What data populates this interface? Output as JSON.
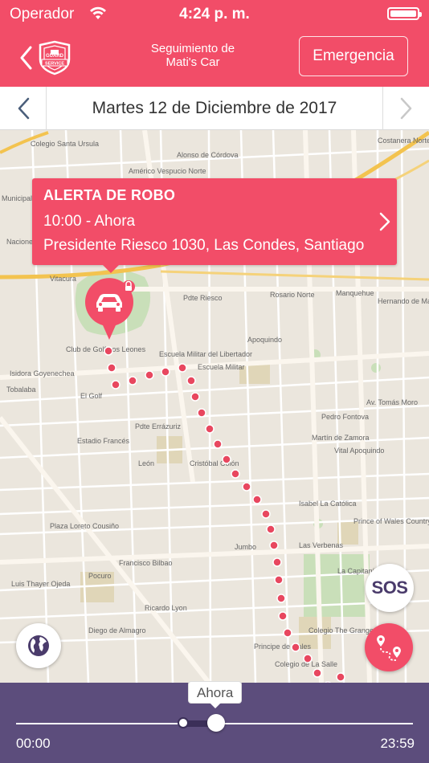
{
  "status": {
    "carrier": "Operador",
    "time": "4:24 p. m."
  },
  "nav": {
    "title_line1": "Seguimiento de",
    "title_line2": "Mati's Car",
    "emergency_label": "Emergencia",
    "logo_text_top": "GUARD",
    "logo_text_bottom": "SERVICE"
  },
  "date_bar": {
    "date": "Martes 12 de Diciembre de 2017"
  },
  "alert": {
    "title": "ALERTA DE ROBO",
    "time": "10:00 - Ahora",
    "address": "Presidente Riesco 1030, Las Condes, Santiago"
  },
  "map": {
    "labels": [
      "Colegio Santa Ursula",
      "Municipalidad de Vitacura",
      "Naciones Unidas",
      "Vitacura",
      "Club de Golf Los Leones",
      "Escuela Militar del Libertador",
      "Escuela Militar",
      "Isidora Goyenechea",
      "El Golf",
      "Tobalaba",
      "Estadio Francés",
      "Pdte Errázuriz",
      "León",
      "Cristóbal Colón",
      "Plaza Loreto Cousiño",
      "Francisco Bilbao",
      "Pocuro",
      "Diego de Almagro",
      "Jumbo",
      "Principe de Gales",
      "Colegio de La Salle",
      "Colegio The Grange School",
      "Prince of Wales Country Club",
      "Isabel La Católica",
      "Apoquindo",
      "Manquehue",
      "Hernando de Magallanes",
      "Costanera Norte",
      "Pdte Riesco",
      "Rosario Norte",
      "Alonso de Córdova",
      "Américo Vespucio Norte",
      "Martín de Zamora",
      "Pedro Fontova",
      "Ricardo Lyon",
      "Luis Thayer Ojeda",
      "Las Verbenas",
      "La Capitanía",
      "Av. Tomás Moro",
      "Vital Apoquindo"
    ]
  },
  "sos_label": "SOS",
  "timeline": {
    "now_label": "Ahora",
    "start_time": "00:00",
    "end_time": "23:59",
    "range_start_fraction": 0.42,
    "range_end_fraction": 0.5
  },
  "colors": {
    "brand": "#f24d68",
    "timeline": "#5c4d7c",
    "route": "#e8475f"
  }
}
